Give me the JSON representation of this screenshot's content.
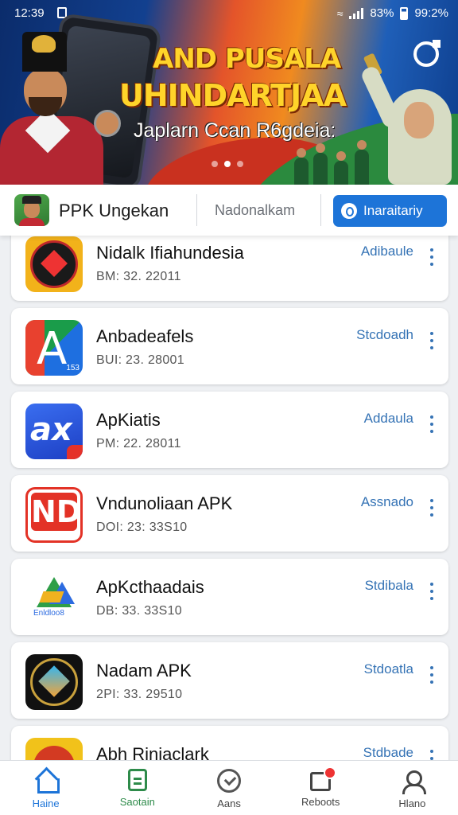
{
  "status_bar": {
    "time": "12:39",
    "battery_left": "83%",
    "battery_right": "99:2%"
  },
  "banner": {
    "title_line1": "AND PUSALA",
    "title_line2": "UHINDARTJAA",
    "subtitle": "Japlarn Ccan R6gdeia:"
  },
  "header": {
    "app_name": "PPK Ungekan",
    "subtitle": "Nadonalkam",
    "install_label": "Inaraitariy"
  },
  "apps": [
    {
      "name": "Nidalk Ifiahundesia",
      "meta": "BM: 32. 22011",
      "status": "Adibaule"
    },
    {
      "name": "Anbadeafels",
      "meta": "BUI: 23. 28001",
      "status": "Stcdoadh"
    },
    {
      "name": "ApKiatis",
      "meta": "PM: 22. 28011",
      "status": "Addaula"
    },
    {
      "name": "Vndunoliaan APK",
      "meta": "DOI: 23: 33S10",
      "status": "Assnado"
    },
    {
      "name": "ApKcthaadais",
      "meta": "DB: 33. 33S10",
      "status": "Stdibala"
    },
    {
      "name": "Nadam APK",
      "meta": "2PI: 33. 29510",
      "status": "Stdoatla"
    },
    {
      "name": "Abh Rinjaclark",
      "meta": "",
      "status": "Stdbade"
    }
  ],
  "icon_texts": {
    "app2": "153",
    "app3": "ax",
    "app4": "ND",
    "app5": "Enldloo8"
  },
  "bottom_nav": [
    {
      "label": "Haine",
      "icon": "home-icon"
    },
    {
      "label": "Saotain",
      "icon": "search-icon"
    },
    {
      "label": "Aans",
      "icon": "download-icon"
    },
    {
      "label": "Reboots",
      "icon": "reports-icon"
    },
    {
      "label": "Hlano",
      "icon": "user-icon"
    }
  ],
  "colors": {
    "accent": "#1d74d8",
    "status_text": "#3573b5",
    "green": "#2e8b4a"
  }
}
